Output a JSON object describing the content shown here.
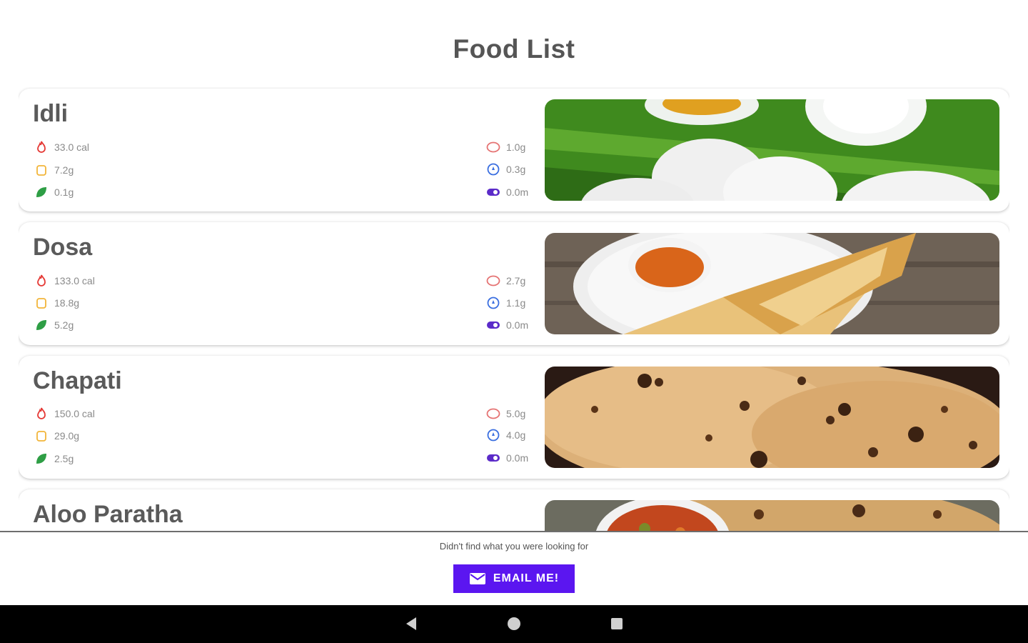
{
  "header": {
    "title": "Food List"
  },
  "foods": [
    {
      "name": "Idli",
      "calories": "33.0 cal",
      "carbs": "7.2g",
      "fiber": "0.1g",
      "protein": "1.0g",
      "fat": "0.3g",
      "cholesterol": "0.0m"
    },
    {
      "name": "Dosa",
      "calories": "133.0 cal",
      "carbs": "18.8g",
      "fiber": "5.2g",
      "protein": "2.7g",
      "fat": "1.1g",
      "cholesterol": "0.0m"
    },
    {
      "name": "Chapati",
      "calories": "150.0 cal",
      "carbs": "29.0g",
      "fiber": "2.5g",
      "protein": "5.0g",
      "fat": "4.0g",
      "cholesterol": "0.0m"
    },
    {
      "name": "Aloo Paratha",
      "calories": "",
      "carbs": "",
      "fiber": "",
      "protein": "",
      "fat": "",
      "cholesterol": ""
    }
  ],
  "footer": {
    "prompt": "Didn't find what you were looking for",
    "email_label": "EMAIL ME!"
  },
  "icons": {
    "calories": "flame-icon",
    "carbs": "bread-icon",
    "fiber": "leaf-icon",
    "protein": "brain-icon",
    "fat": "droplet-icon",
    "cholesterol": "pill-icon"
  },
  "colors": {
    "accent": "#5b16f0",
    "calories": "#e53935",
    "carbs": "#f2b53a",
    "fiber": "#2e9e45",
    "protein": "#e57373",
    "fat": "#3b6fe0",
    "cholesterol": "#5b2bc9"
  }
}
